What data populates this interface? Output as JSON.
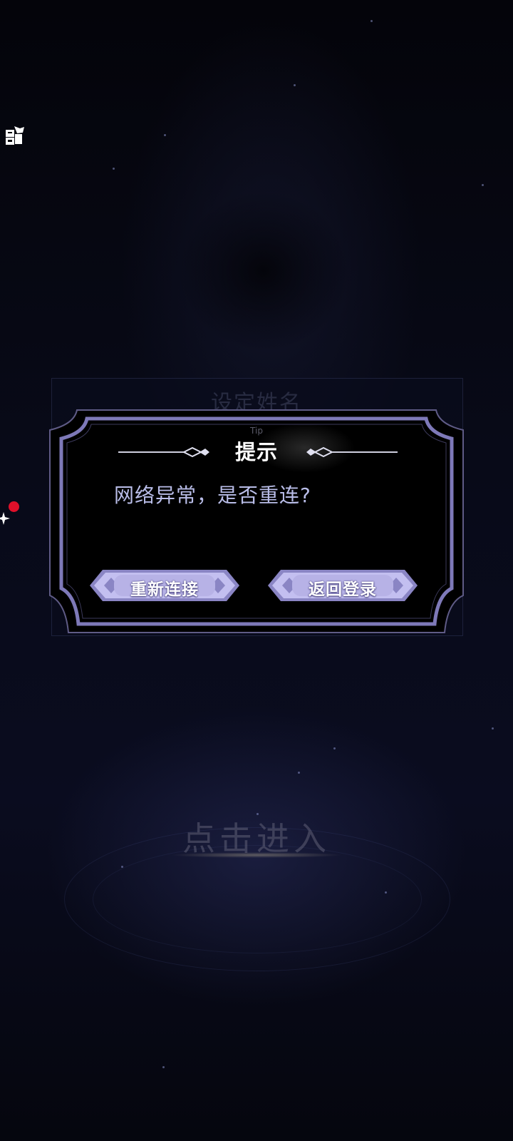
{
  "background": {
    "panel_title": "设定姓名",
    "enter_label": "点击进入"
  },
  "dialog": {
    "subtitle": "Tip",
    "title": "提示",
    "message": "网络异常，是否重连?",
    "buttons": {
      "reconnect": "重新连接",
      "back_to_login": "返回登录"
    }
  },
  "colors": {
    "frame": "#7e79b8",
    "button_fill": "#b7b2e6",
    "message_text": "#b9bde8",
    "notification_dot": "#e0102a"
  },
  "icons": {
    "side_icon": "puzzle-icon",
    "notification": "red-dot-badge",
    "sparkle": "sparkle-icon"
  }
}
